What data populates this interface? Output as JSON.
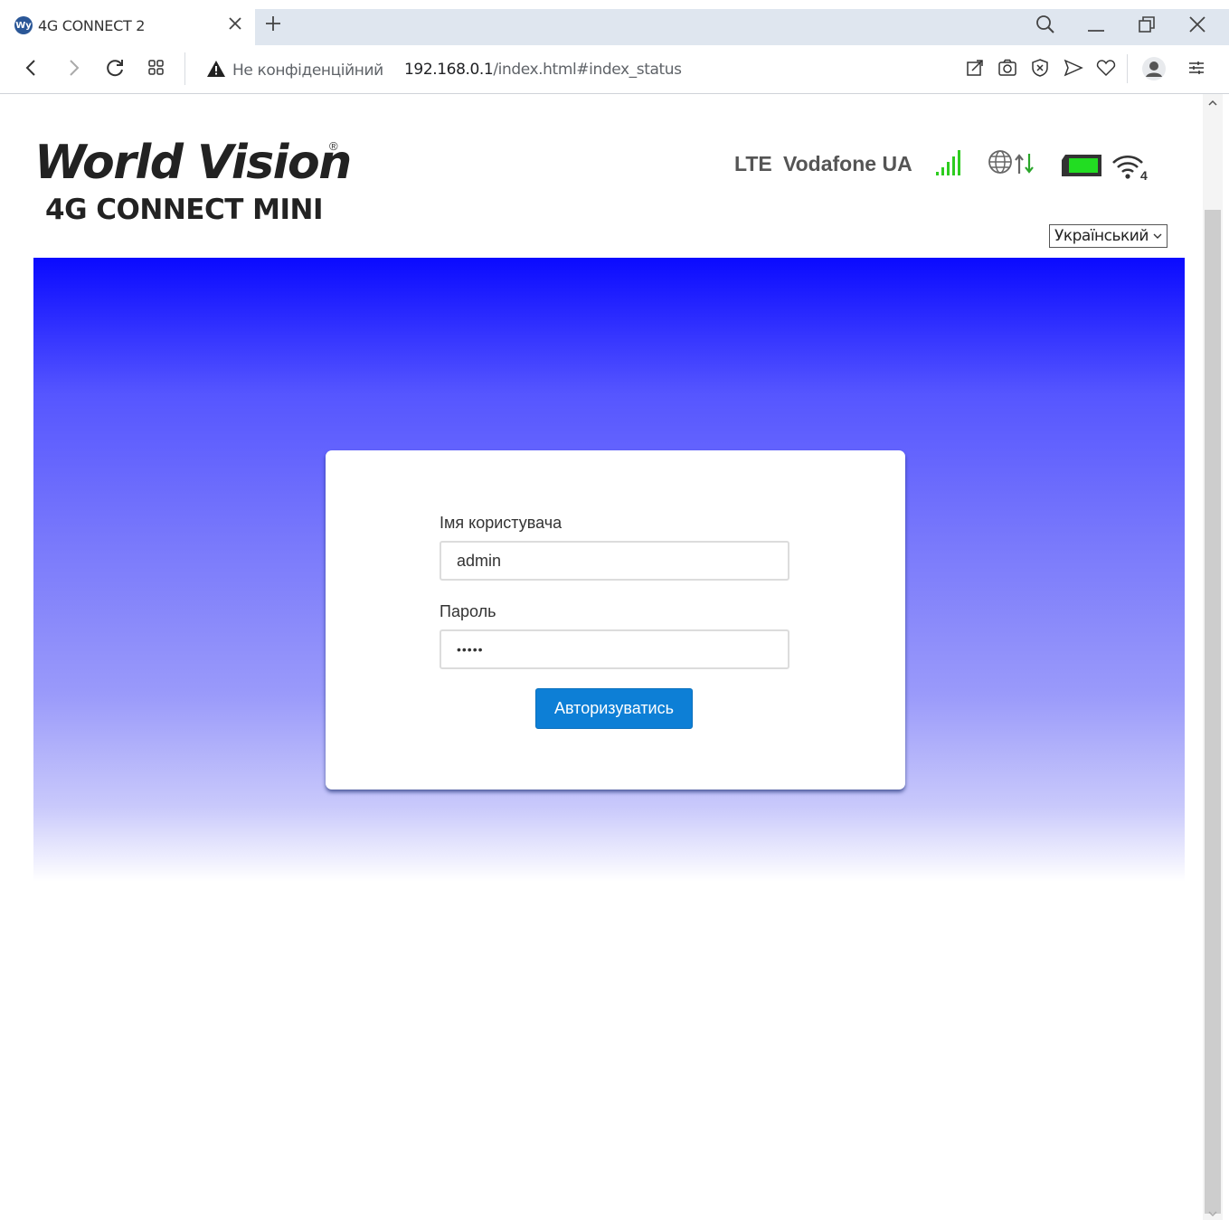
{
  "browser": {
    "tab_title": "4G CONNECT 2",
    "favicon_text": "Wy",
    "security_text": "Не конфіденційний",
    "url_host": "192.168.0.1",
    "url_path": "/index.html#index_status"
  },
  "header": {
    "logo_main": "World Vision",
    "logo_reg": "®",
    "logo_sub": "4G CONNECT MINI",
    "network_type": "LTE",
    "operator": "Vodafone UA",
    "wifi_clients": "4",
    "language": "Український"
  },
  "login": {
    "username_label": "Імя користувача",
    "username_value": "admin",
    "password_label": "Пароль",
    "password_value": "•••••",
    "submit_label": "Авторизуватись"
  },
  "colors": {
    "banner_top": "#0a0aff",
    "button": "#0d7fd6",
    "signal": "#2ecc1f",
    "battery": "#22dd22"
  },
  "icons": [
    "back-icon",
    "forward-icon",
    "reload-icon",
    "apps-icon",
    "warning-icon",
    "share-icon",
    "camera-icon",
    "block-icon",
    "send-icon",
    "heart-icon",
    "profile-icon",
    "menu-icon",
    "search-icon",
    "minimize-icon",
    "restore-icon",
    "close-icon",
    "signal-icon",
    "globe-icon",
    "data-arrows-icon",
    "battery-icon",
    "wifi-icon"
  ]
}
